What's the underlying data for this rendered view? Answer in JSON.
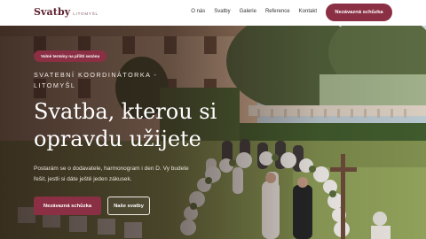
{
  "brand": {
    "name": "Svatby",
    "sub": "LITOMYŠL"
  },
  "nav": {
    "items": [
      "O nás",
      "Svatby",
      "Galerie",
      "Reference",
      "Kontakt"
    ],
    "cta": "Nezávazná schůzka"
  },
  "hero": {
    "badge": "Volné termíny na příští sezónu",
    "eyebrow_line1": "SVATEBNÍ KOORDINÁTORKA -",
    "eyebrow_line2": "LITOMYŠL",
    "title": "Svatba, kterou si opravdu užijete",
    "description": "Postarám se o dodavatele, harmonogram i den D. Vy budete řešit, jestli si dáte ještě jeden zákusek.",
    "primary_button": "Nezávazná schůzka",
    "secondary_button": "Naše svatby"
  },
  "colors": {
    "accent": "#8a2f44",
    "brand": "#5a1e2e"
  }
}
